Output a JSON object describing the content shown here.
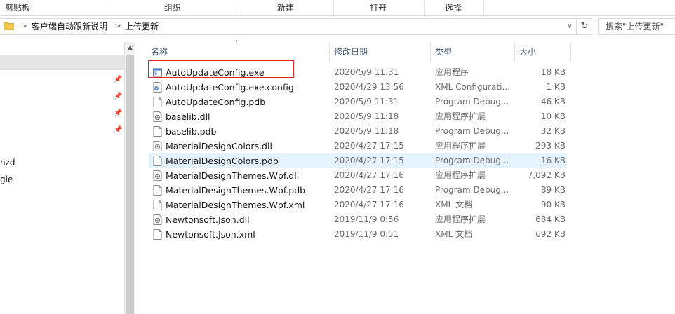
{
  "ribbon": {
    "groups": [
      "剪贴板",
      "组织",
      "新建",
      "打开",
      "选择"
    ]
  },
  "address": {
    "path": [
      "客户端自动跟新说明",
      "上传更新"
    ],
    "search_placeholder": "搜索\"上传更新\""
  },
  "nav": {
    "items": [
      "nzd",
      "gle"
    ]
  },
  "columns": {
    "name": "名称",
    "date": "修改日期",
    "type": "类型",
    "size": "大小"
  },
  "files": [
    {
      "name": "AutoUpdateConfig.exe",
      "date": "2020/5/9 11:31",
      "type": "应用程序",
      "size": "18 KB",
      "icon": "exe-icon"
    },
    {
      "name": "AutoUpdateConfig.exe.config",
      "date": "2020/4/29 13:56",
      "type": "XML Configurati...",
      "size": "1 KB",
      "icon": "config-icon"
    },
    {
      "name": "AutoUpdateConfig.pdb",
      "date": "2020/5/9 11:31",
      "type": "Program Debug...",
      "size": "46 KB",
      "icon": "file-icon"
    },
    {
      "name": "baselib.dll",
      "date": "2020/5/9 11:18",
      "type": "应用程序扩展",
      "size": "10 KB",
      "icon": "dll-icon"
    },
    {
      "name": "baselib.pdb",
      "date": "2020/5/9 11:18",
      "type": "Program Debug...",
      "size": "32 KB",
      "icon": "file-icon"
    },
    {
      "name": "MaterialDesignColors.dll",
      "date": "2020/4/27 17:15",
      "type": "应用程序扩展",
      "size": "293 KB",
      "icon": "dll-icon"
    },
    {
      "name": "MaterialDesignColors.pdb",
      "date": "2020/4/27 17:15",
      "type": "Program Debug...",
      "size": "16 KB",
      "icon": "file-icon"
    },
    {
      "name": "MaterialDesignThemes.Wpf.dll",
      "date": "2020/4/27 17:16",
      "type": "应用程序扩展",
      "size": "7,092 KB",
      "icon": "dll-icon"
    },
    {
      "name": "MaterialDesignThemes.Wpf.pdb",
      "date": "2020/4/27 17:16",
      "type": "Program Debug...",
      "size": "89 KB",
      "icon": "file-icon"
    },
    {
      "name": "MaterialDesignThemes.Wpf.xml",
      "date": "2020/4/27 17:16",
      "type": "XML 文档",
      "size": "90 KB",
      "icon": "file-icon"
    },
    {
      "name": "Newtonsoft.Json.dll",
      "date": "2019/11/9 0:56",
      "type": "应用程序扩展",
      "size": "684 KB",
      "icon": "dll-icon"
    },
    {
      "name": "Newtonsoft.Json.xml",
      "date": "2019/11/9 0:51",
      "type": "XML 文档",
      "size": "692 KB",
      "icon": "file-icon"
    }
  ],
  "colors": {
    "highlight_row": "#e5f3ff",
    "annotation_box": "#e0262b",
    "header_text": "#4c607a"
  }
}
